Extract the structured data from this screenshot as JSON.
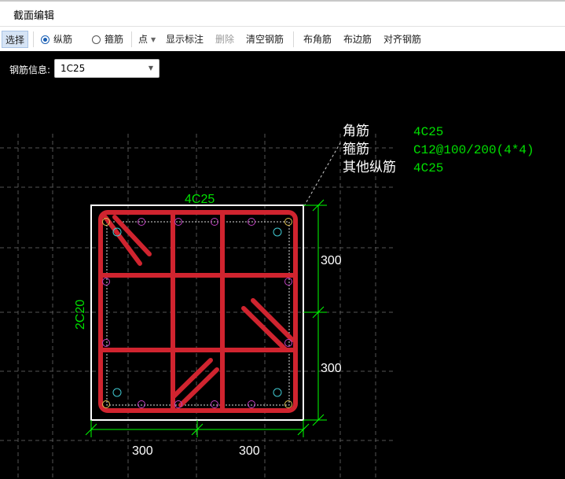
{
  "window": {
    "title": "截面编辑"
  },
  "toolbar": {
    "select": "选择",
    "longitudinal": "纵筋",
    "stirrup": "箍筋",
    "point": "点",
    "show_label": "显示标注",
    "delete": "删除",
    "clear": "清空钢筋",
    "corner": "布角筋",
    "edge": "布边筋",
    "align": "对齐钢筋"
  },
  "rebar_info": {
    "label": "钢筋信息:",
    "value": "1C25"
  },
  "drawing": {
    "top_label": "4C25",
    "side_label": "2C20",
    "dim_right_top": "300",
    "dim_right_bottom": "300",
    "dim_bottom_left": "300",
    "dim_bottom_right": "300",
    "legend": {
      "corner_label": "角筋",
      "corner_value": "4C25",
      "stirrup_label": "箍筋",
      "stirrup_value": "C12@100/200(4*4)",
      "other_label": "其他纵筋",
      "other_value": "4C25"
    },
    "colors": {
      "rebar": "#d0242f",
      "dim": "#00ff00",
      "text_green": "#00e000",
      "magenta": "#c040c0",
      "cyan": "#40c8d0"
    }
  }
}
